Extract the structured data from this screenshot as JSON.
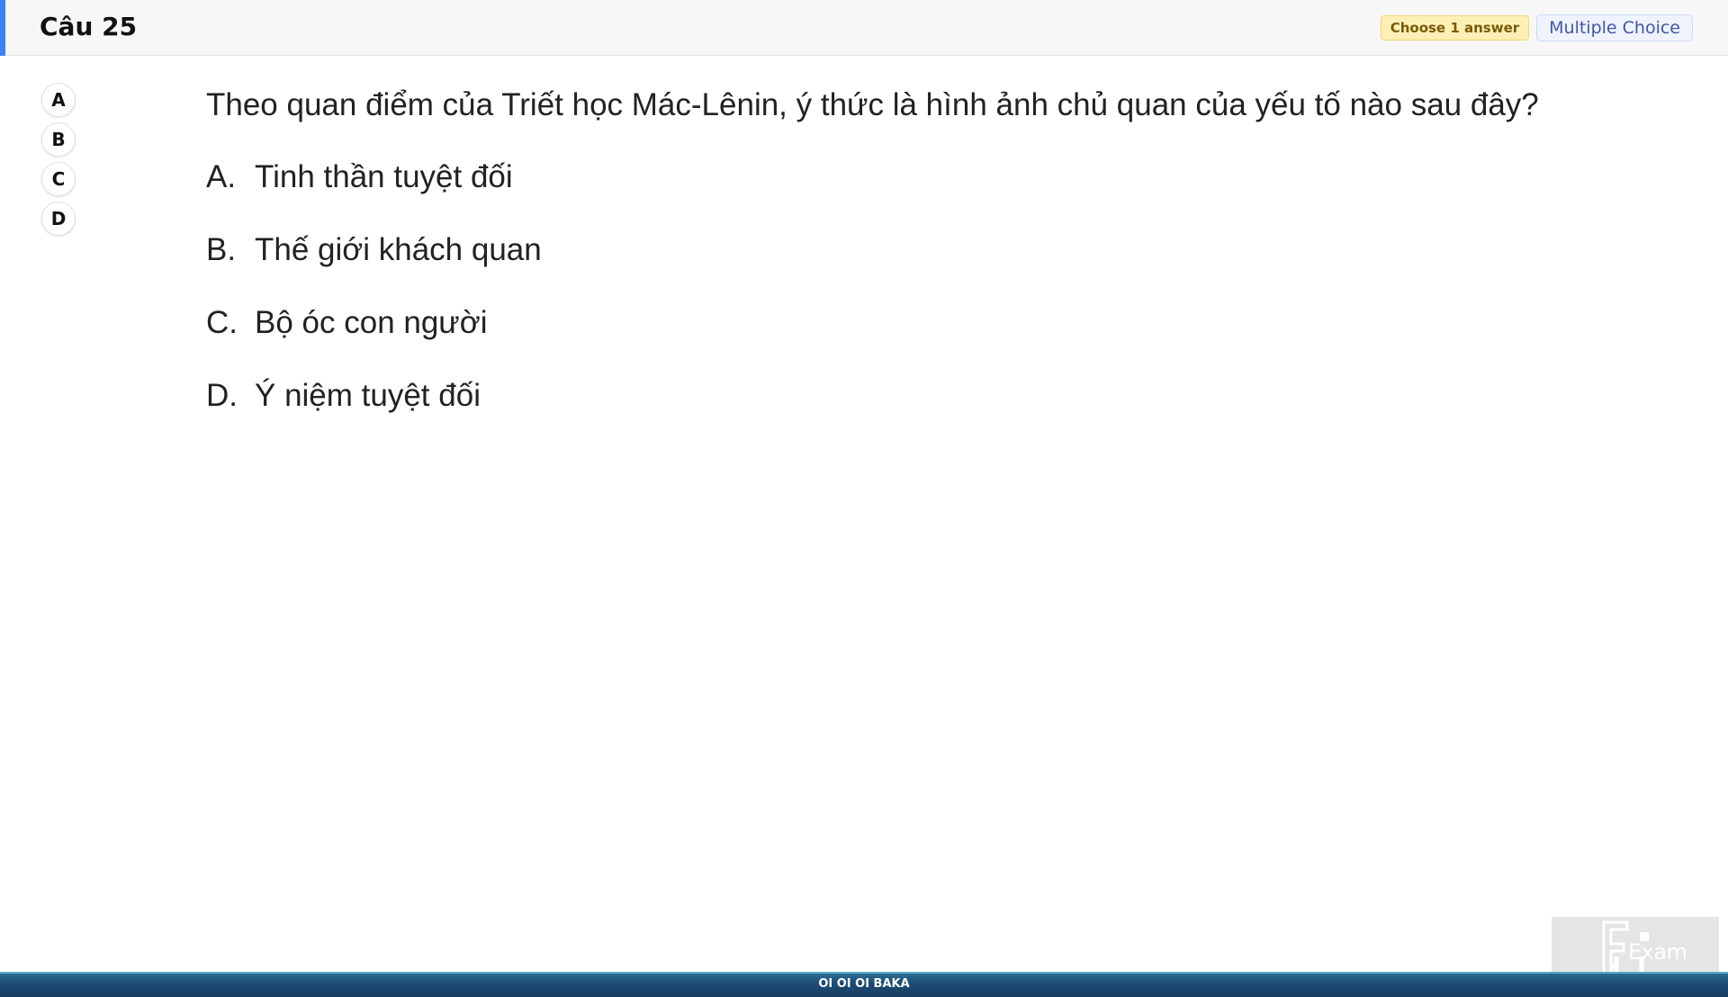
{
  "header": {
    "title": "Câu 25",
    "choose_badge": "Choose 1 answer",
    "type_badge": "Multiple Choice"
  },
  "colors": {
    "accent": "#3b82f6",
    "choose_badge_bg": "#fdf0b5",
    "type_badge_text": "#4356a8",
    "footer_bar": "#1d4c74"
  },
  "answer_nav": [
    "A",
    "B",
    "C",
    "D"
  ],
  "question": {
    "text": "Theo quan điểm của Triết học Mác-Lênin, ý thức là hình ảnh chủ quan của yếu tố nào sau đây?"
  },
  "options": [
    {
      "letter": "A.",
      "text": "Tinh thần tuyệt đối"
    },
    {
      "letter": "B.",
      "text": "Thế giới khách quan"
    },
    {
      "letter": "C.",
      "text": "Bộ óc con người"
    },
    {
      "letter": "D.",
      "text": "Ý niệm tuyệt đối"
    }
  ],
  "footer": {
    "text": "OI OI OI BAKA"
  },
  "logo": {
    "icon": "fu-exam-logo-icon",
    "text": "Exam"
  }
}
